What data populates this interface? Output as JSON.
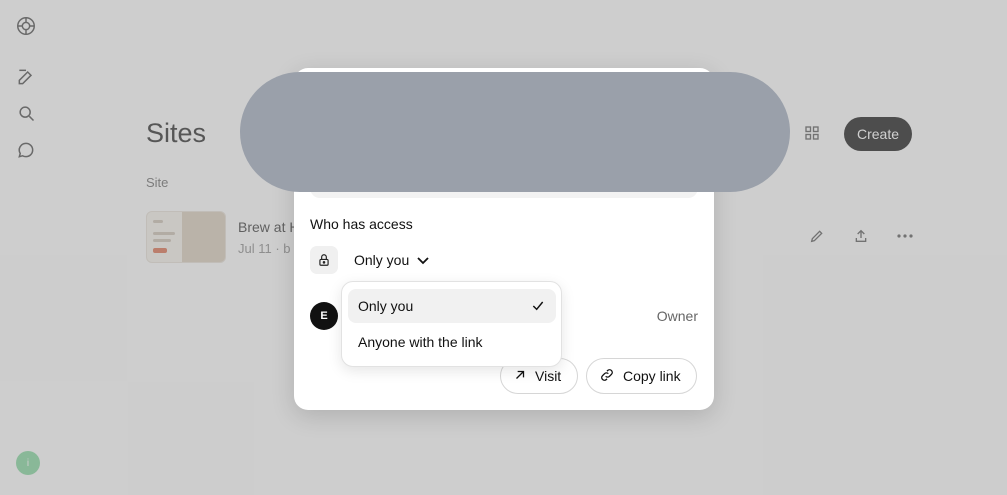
{
  "background": {
    "page_title": "Sites",
    "column_header": "Site",
    "site": {
      "name": "Brew at H",
      "date": "Jul 11 · b"
    },
    "create_label": "Create",
    "user_avatar_initial": "i"
  },
  "modal": {
    "access_label": "Who has access",
    "access_value": "Only you",
    "owner": {
      "initial": "E",
      "role": "Owner"
    },
    "buttons": {
      "visit_label": "Visit",
      "copy_link_label": "Copy link"
    }
  },
  "dropdown": {
    "options": [
      {
        "label": "Only you",
        "selected": true
      },
      {
        "label": "Anyone with the link",
        "selected": false
      }
    ]
  },
  "icons": {
    "sidebar": [
      "logo-icon",
      "new-chat-icon",
      "search-icon",
      "chat-icon"
    ],
    "row_actions": [
      "edit-icon",
      "share-icon",
      "more-icon"
    ]
  },
  "colors": {
    "accent": "#111111",
    "redaction": "#9aa0aa",
    "avatar": "#7fd49a"
  }
}
